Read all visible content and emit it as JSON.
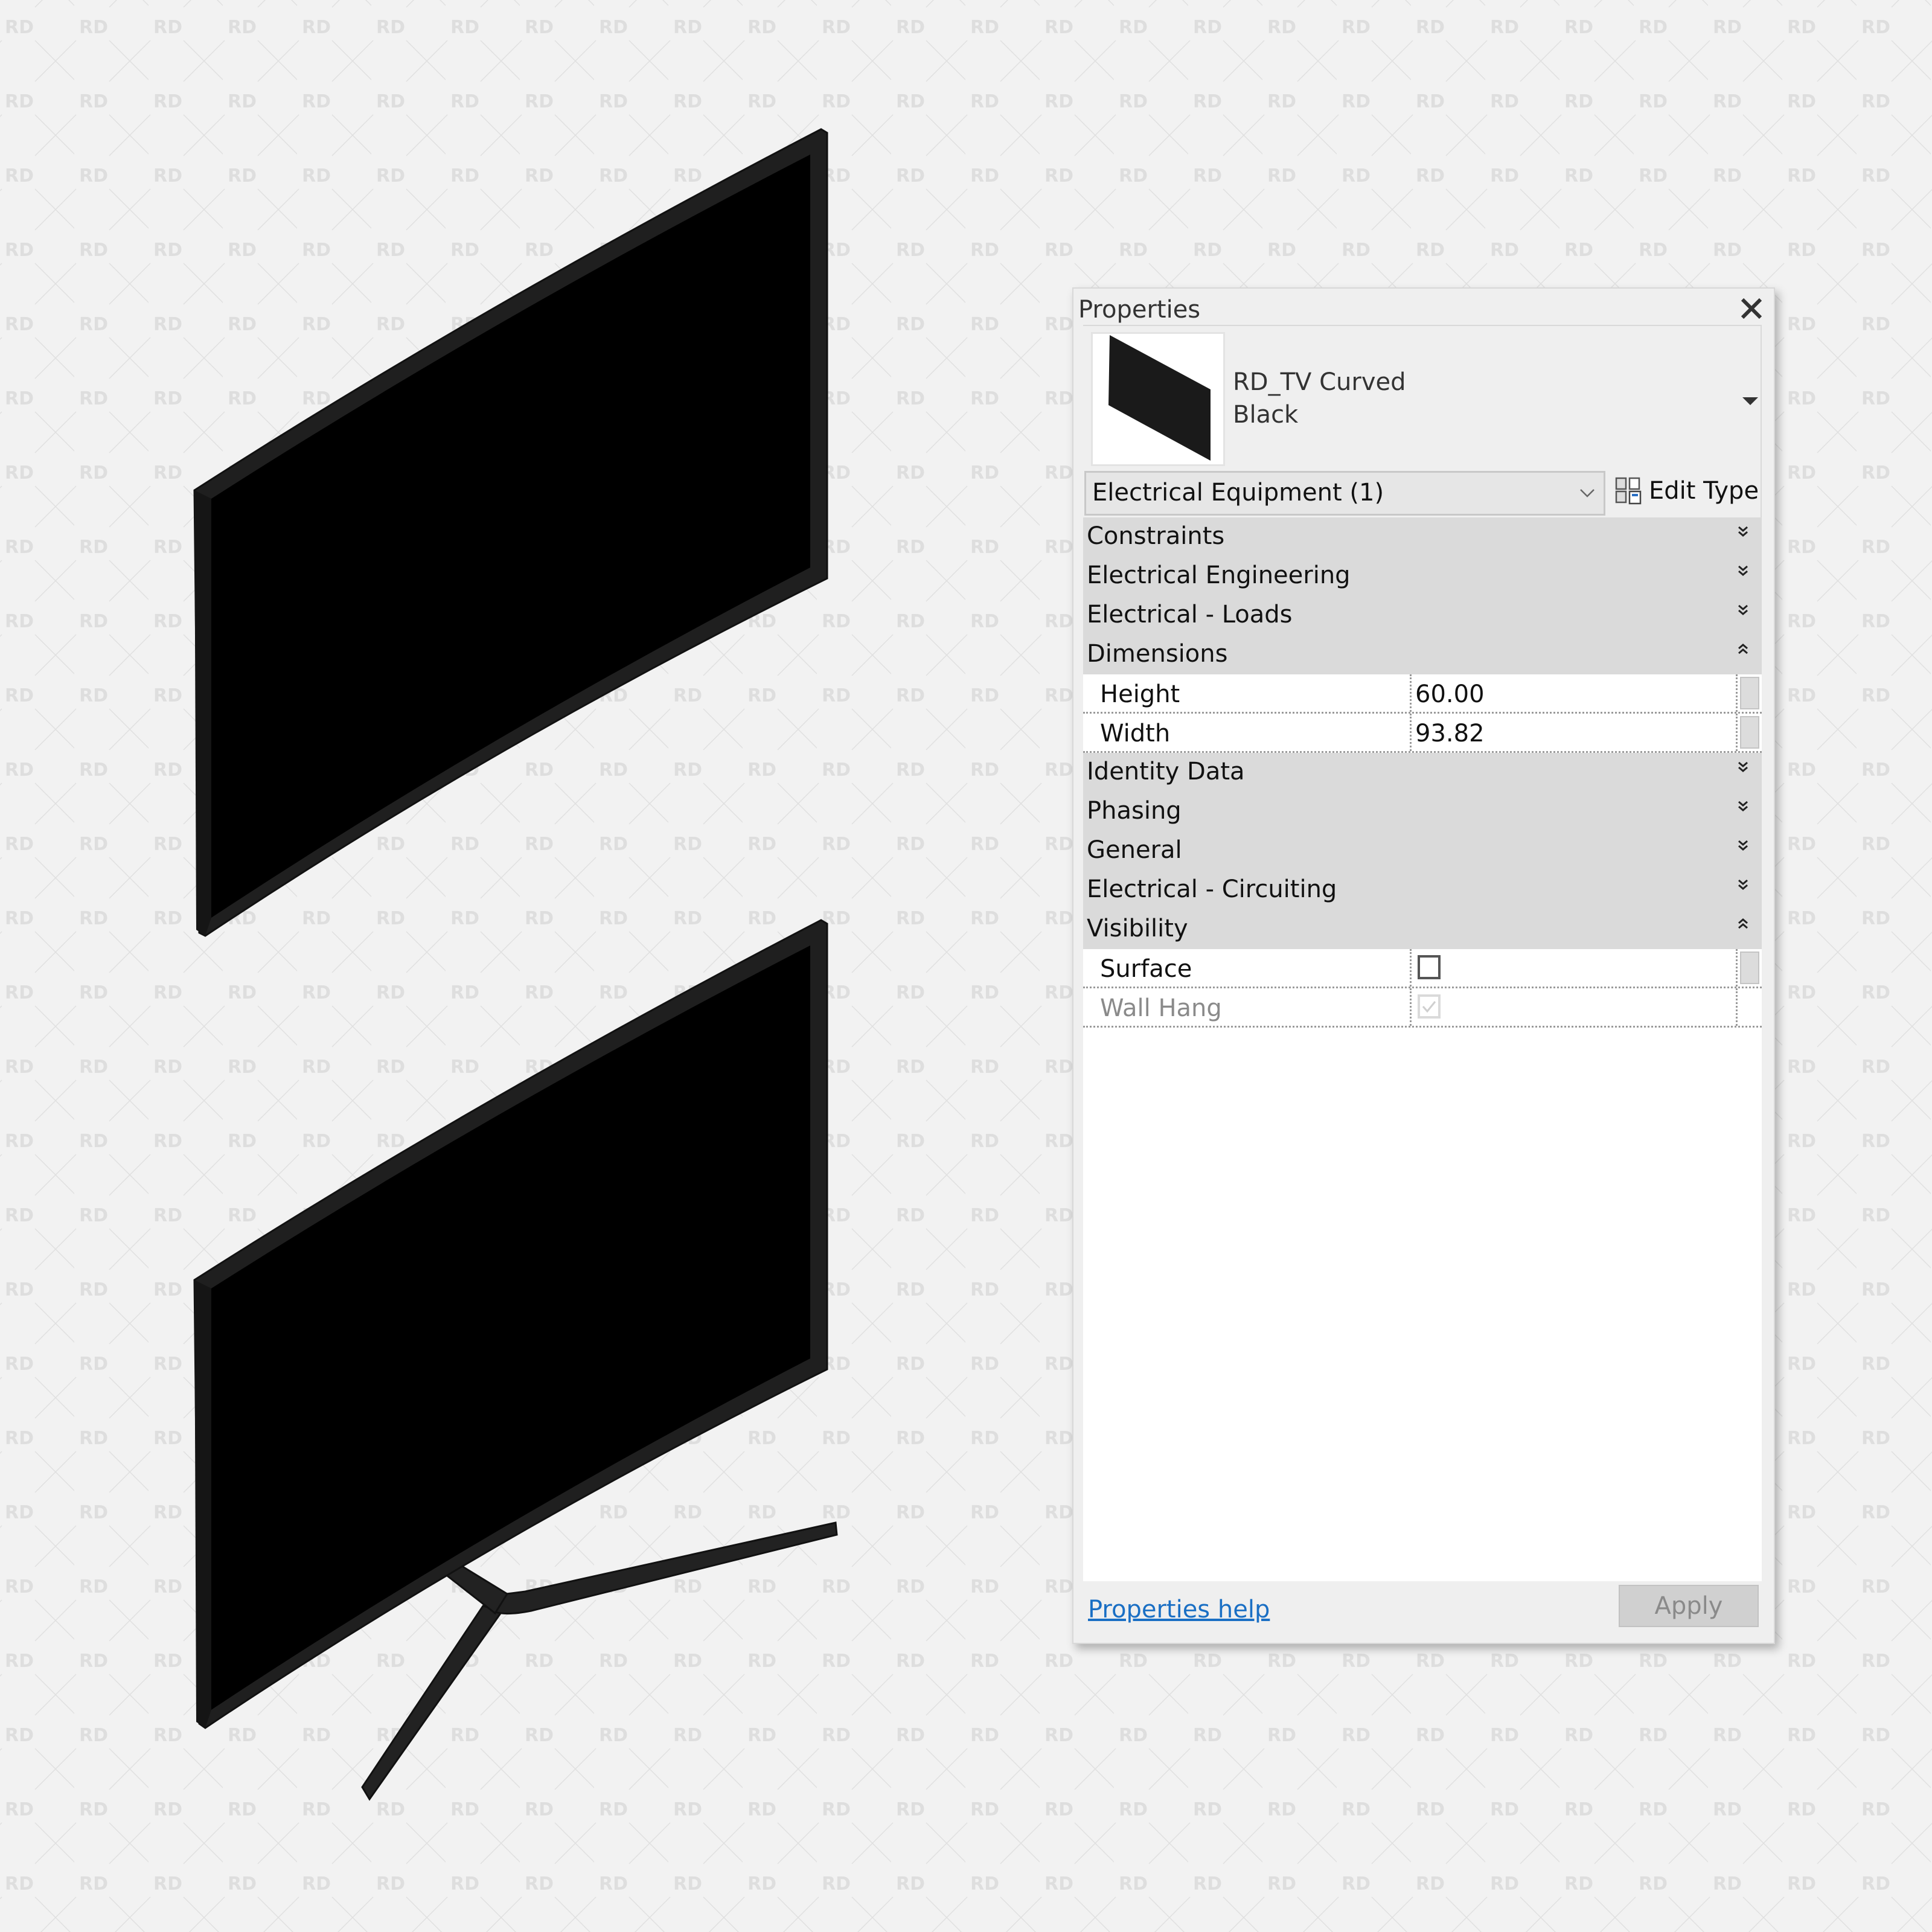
{
  "viewport": {
    "watermark_text": "RD",
    "models": [
      {
        "name": "tv-wall-hung",
        "mounting": "wall hang",
        "screen_color": "#000000",
        "bezel_color": "#1f1f1f"
      },
      {
        "name": "tv-with-stand",
        "mounting": "surface",
        "screen_color": "#000000",
        "bezel_color": "#1f1f1f",
        "stand_color": "#222222"
      }
    ]
  },
  "properties": {
    "title": "Properties",
    "close_icon": "close-icon",
    "type_selector": {
      "name_line1": "RD_TV Curved",
      "name_line2": "Black",
      "dropdown_icon": "triangle-down-icon"
    },
    "category_filter": {
      "value": "Electrical Equipment (1)",
      "dropdown_icon": "chevron-down-icon"
    },
    "edit_type": {
      "label": "Edit Type",
      "icon": "edit-type-icon"
    },
    "groups": [
      {
        "label": "Constraints",
        "expanded": false
      },
      {
        "label": "Electrical Engineering",
        "expanded": false
      },
      {
        "label": "Electrical - Loads",
        "expanded": false
      },
      {
        "label": "Dimensions",
        "expanded": true,
        "params": [
          {
            "name": "Height",
            "value": "60.00"
          },
          {
            "name": "Width",
            "value": "93.82"
          }
        ]
      },
      {
        "label": "Identity Data",
        "expanded": false
      },
      {
        "label": "Phasing",
        "expanded": false
      },
      {
        "label": "General",
        "expanded": false
      },
      {
        "label": "Electrical - Circuiting",
        "expanded": false
      },
      {
        "label": "Visibility",
        "expanded": true,
        "params": [
          {
            "name": "Surface",
            "checked": false,
            "enabled": true
          },
          {
            "name": "Wall Hang",
            "checked": true,
            "enabled": false
          }
        ]
      }
    ],
    "footer": {
      "help_link": "Properties help",
      "apply_label": "Apply"
    }
  }
}
